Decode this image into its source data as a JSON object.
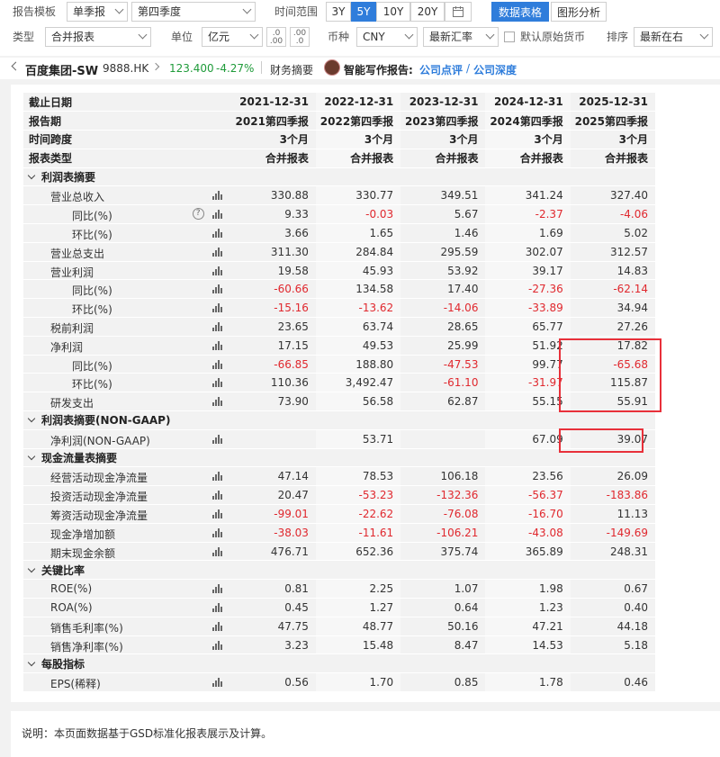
{
  "toolbar": {
    "template_label": "报告模板",
    "report_type": "单季报",
    "quarter": "第四季度",
    "time_range_label": "时间范围",
    "ranges": [
      "3Y",
      "5Y",
      "10Y",
      "20Y"
    ],
    "active_range": "5Y",
    "view_table": "数据表格",
    "view_chart": "图形分析",
    "type_label": "类型",
    "type_value": "合并报表",
    "unit_label": "单位",
    "unit_value": "亿元",
    "currency_label": "币种",
    "currency_value": "CNY",
    "rate_value": "最新汇率",
    "default_currency_label": "默认原始货币",
    "sort_label": "排序",
    "sort_value": "最新在右"
  },
  "crumb": {
    "company": "百度集团-SW",
    "code": "9888.HK",
    "price": "123.400",
    "change": "-4.27%",
    "page": "财务摘要",
    "ai_report": "智能写作报告:",
    "link1": "公司点评",
    "sep": "/",
    "link2": "公司深度"
  },
  "colors": {
    "accent": "#2f7ddb",
    "negative": "#e0282e",
    "positive": "#1f9b3a",
    "highlight": "#e8303a"
  },
  "table": {
    "header_rows": [
      {
        "label": "截止日期",
        "values": [
          "2021-12-31",
          "2022-12-31",
          "2023-12-31",
          "2024-12-31",
          "2025-12-31"
        ]
      },
      {
        "label": "报告期",
        "values": [
          "2021第四季报",
          "2022第四季报",
          "2023第四季报",
          "2024第四季报",
          "2025第四季报"
        ]
      },
      {
        "label": "时间跨度",
        "values": [
          "3个月",
          "3个月",
          "3个月",
          "3个月",
          "3个月"
        ]
      },
      {
        "label": "报表类型",
        "values": [
          "合并报表",
          "合并报表",
          "合并报表",
          "合并报表",
          "合并报表"
        ]
      }
    ],
    "rows": [
      {
        "kind": "section",
        "label": "利润表摘要"
      },
      {
        "kind": "row",
        "indent": 1,
        "label": "营业总收入",
        "values": [
          "330.88",
          "330.77",
          "349.51",
          "341.24",
          "327.40"
        ]
      },
      {
        "kind": "row",
        "indent": 2,
        "label": "同比(%)",
        "help": true,
        "values": [
          "9.33",
          "-0.03",
          "5.67",
          "-2.37",
          "-4.06"
        ]
      },
      {
        "kind": "row",
        "indent": 2,
        "label": "环比(%)",
        "values": [
          "3.66",
          "1.65",
          "1.46",
          "1.69",
          "5.02"
        ]
      },
      {
        "kind": "row",
        "indent": 1,
        "label": "营业总支出",
        "values": [
          "311.30",
          "284.84",
          "295.59",
          "302.07",
          "312.57"
        ]
      },
      {
        "kind": "row",
        "indent": 1,
        "label": "营业利润",
        "values": [
          "19.58",
          "45.93",
          "53.92",
          "39.17",
          "14.83"
        ]
      },
      {
        "kind": "row",
        "indent": 2,
        "label": "同比(%)",
        "values": [
          "-60.66",
          "134.58",
          "17.40",
          "-27.36",
          "-62.14"
        ]
      },
      {
        "kind": "row",
        "indent": 2,
        "label": "环比(%)",
        "values": [
          "-15.16",
          "-13.62",
          "-14.06",
          "-33.89",
          "34.94"
        ]
      },
      {
        "kind": "row",
        "indent": 1,
        "label": "税前利润",
        "values": [
          "23.65",
          "63.74",
          "28.65",
          "65.77",
          "27.26"
        ]
      },
      {
        "kind": "row",
        "indent": 1,
        "label": "净利润",
        "values": [
          "17.15",
          "49.53",
          "25.99",
          "51.92",
          "17.82"
        ]
      },
      {
        "kind": "row",
        "indent": 2,
        "label": "同比(%)",
        "values": [
          "-66.85",
          "188.80",
          "-47.53",
          "99.77",
          "-65.68"
        ]
      },
      {
        "kind": "row",
        "indent": 2,
        "label": "环比(%)",
        "values": [
          "110.36",
          "3,492.47",
          "-61.10",
          "-31.97",
          "115.87"
        ]
      },
      {
        "kind": "row",
        "indent": 1,
        "label": "研发支出",
        "values": [
          "73.90",
          "56.58",
          "62.87",
          "55.15",
          "55.91"
        ]
      },
      {
        "kind": "section",
        "label": "利润表摘要(NON-GAAP)"
      },
      {
        "kind": "row",
        "indent": 1,
        "label": "净利润(NON-GAAP)",
        "values": [
          "",
          "53.71",
          "",
          "67.09",
          "39.07"
        ]
      },
      {
        "kind": "section",
        "label": "现金流量表摘要"
      },
      {
        "kind": "row",
        "indent": 1,
        "label": "经营活动现金净流量",
        "values": [
          "47.14",
          "78.53",
          "106.18",
          "23.56",
          "26.09"
        ]
      },
      {
        "kind": "row",
        "indent": 1,
        "label": "投资活动现金净流量",
        "values": [
          "20.47",
          "-53.23",
          "-132.36",
          "-56.37",
          "-183.86"
        ]
      },
      {
        "kind": "row",
        "indent": 1,
        "label": "筹资活动现金净流量",
        "values": [
          "-99.01",
          "-22.62",
          "-76.08",
          "-16.70",
          "11.13"
        ]
      },
      {
        "kind": "row",
        "indent": 1,
        "label": "现金净增加额",
        "values": [
          "-38.03",
          "-11.61",
          "-106.21",
          "-43.08",
          "-149.69"
        ]
      },
      {
        "kind": "row",
        "indent": 1,
        "label": "期末现金余额",
        "values": [
          "476.71",
          "652.36",
          "375.74",
          "365.89",
          "248.31"
        ]
      },
      {
        "kind": "section",
        "label": "关键比率"
      },
      {
        "kind": "row",
        "indent": 1,
        "label": "ROE(%)",
        "values": [
          "0.81",
          "2.25",
          "1.07",
          "1.98",
          "0.67"
        ]
      },
      {
        "kind": "row",
        "indent": 1,
        "label": "ROA(%)",
        "values": [
          "0.45",
          "1.27",
          "0.64",
          "1.23",
          "0.40"
        ]
      },
      {
        "kind": "row",
        "indent": 1,
        "label": "销售毛利率(%)",
        "values": [
          "47.75",
          "48.77",
          "50.16",
          "47.21",
          "44.18"
        ]
      },
      {
        "kind": "row",
        "indent": 1,
        "label": "销售净利率(%)",
        "values": [
          "3.23",
          "15.48",
          "8.47",
          "14.53",
          "5.18"
        ]
      },
      {
        "kind": "section",
        "label": "每股指标"
      },
      {
        "kind": "row",
        "indent": 1,
        "label": "EPS(稀释)",
        "values": [
          "0.56",
          "1.70",
          "0.85",
          "1.78",
          "0.46"
        ]
      }
    ]
  },
  "footer": {
    "note": "说明：本页面数据基于GSD标准化报表展示及计算。"
  }
}
